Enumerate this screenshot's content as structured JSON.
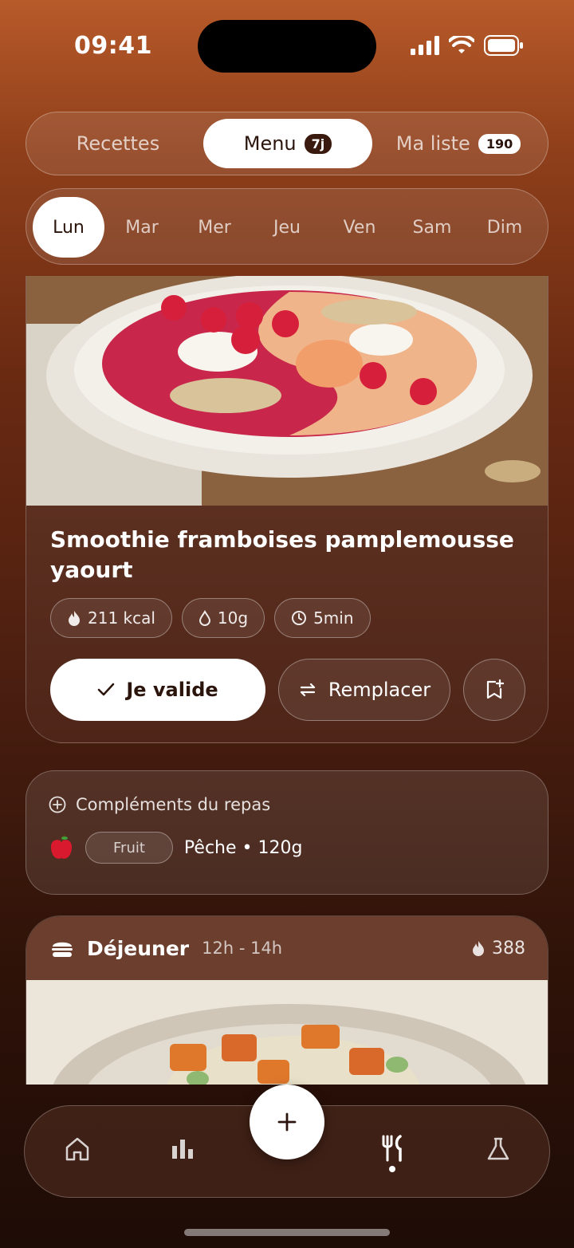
{
  "status": {
    "time": "09:41"
  },
  "tabs": [
    {
      "label": "Recettes"
    },
    {
      "label": "Menu",
      "badge": "7j"
    },
    {
      "label": "Ma liste",
      "badge": "190"
    }
  ],
  "days": [
    "Lun",
    "Mar",
    "Mer",
    "Jeu",
    "Ven",
    "Sam",
    "Dim"
  ],
  "meal": {
    "title": "Smoothie framboises pamplemousse yaourt",
    "kcal": "211 kcal",
    "fat": "10g",
    "time": "5min",
    "validate_label": "Je valide",
    "replace_label": "Remplacer"
  },
  "complements": {
    "title": "Compléments du repas",
    "tag": "Fruit",
    "value": "Pêche • 120g"
  },
  "lunch": {
    "title": "Déjeuner",
    "time": "12h - 14h",
    "kcal": "388"
  },
  "colors": {
    "accent": "#b85a2a",
    "dark": "#2a140c"
  }
}
